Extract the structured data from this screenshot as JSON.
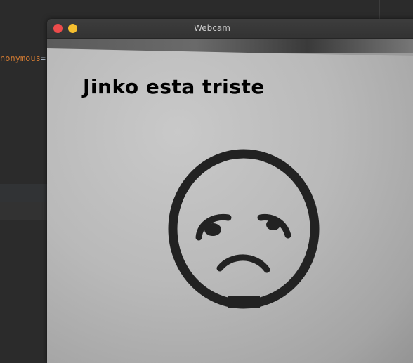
{
  "editor": {
    "code_fragment_keyword": "nonymous",
    "code_fragment_operator": "="
  },
  "window": {
    "title": "Webcam"
  },
  "feed": {
    "overlay_text": "Jinko esta triste",
    "overlay_color": "#000000",
    "drawing": "sad-face-drawing"
  }
}
